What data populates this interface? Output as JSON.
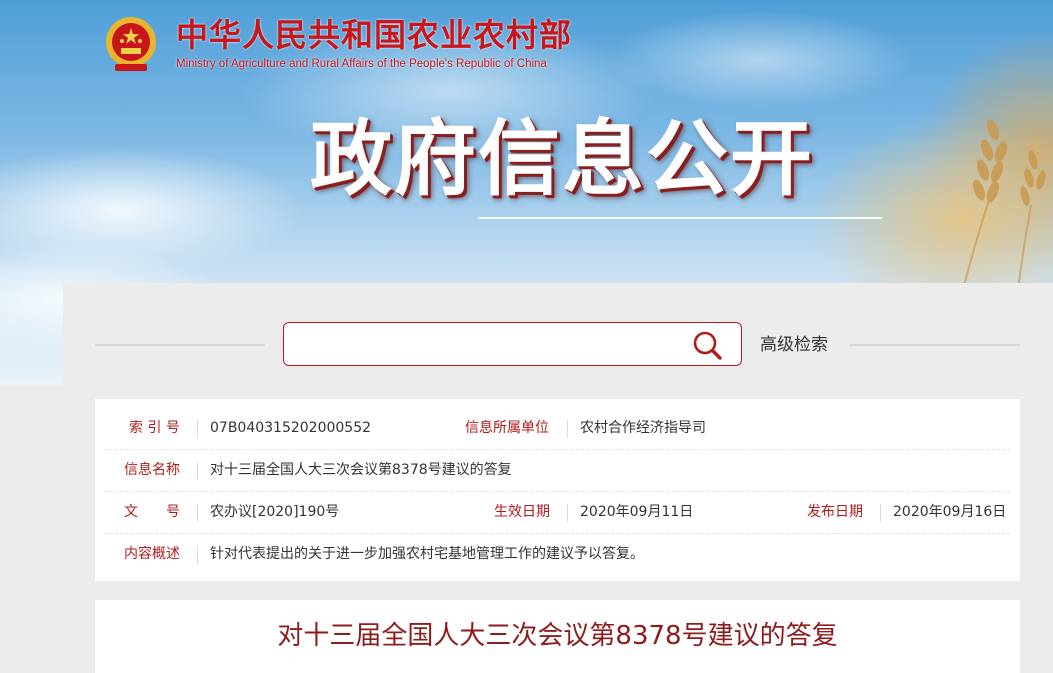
{
  "header": {
    "ministry_cn": "中华人民共和国农业农村部",
    "ministry_en": "Ministry of Agriculture and Rural Affairs of the People's Republic of China",
    "banner_title": "政府信息公开"
  },
  "search": {
    "value": "",
    "placeholder": "",
    "advanced_label": "高级检索"
  },
  "meta": {
    "index_label": "索 引 号",
    "index_value": "07B040315202000552",
    "org_label": "信息所属单位",
    "org_value": "农村合作经济指导司",
    "name_label": "信息名称",
    "name_value": "对十三届全国人大三次会议第8378号建议的答复",
    "doc_label": "文　　号",
    "doc_value": "农办议[2020]190号",
    "effective_label": "生效日期",
    "effective_value": "2020年09月11日",
    "publish_label": "发布日期",
    "publish_value": "2020年09月16日",
    "summary_label": "内容概述",
    "summary_value": "针对代表提出的关于进一步加强农村宅基地管理工作的建议予以答复。"
  },
  "article": {
    "title": "对十三届全国人大三次会议第8378号建议的答复"
  },
  "colors": {
    "brand_red": "#c8161d",
    "label_red": "#b31b1b",
    "title_red": "#8e1c1c"
  },
  "icons": [
    "national-emblem-icon",
    "search-icon",
    "wheat-decoration"
  ]
}
